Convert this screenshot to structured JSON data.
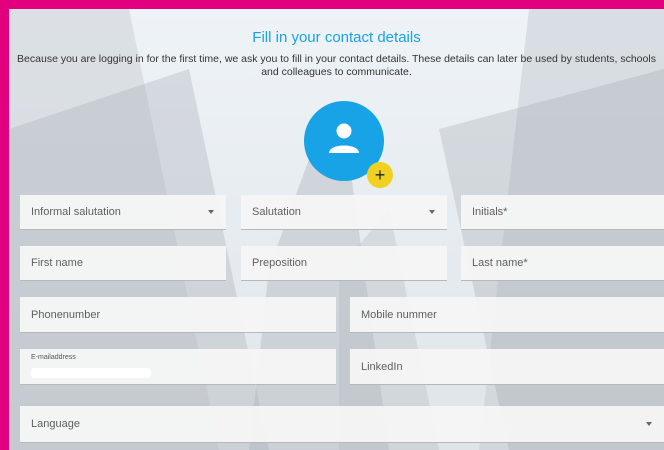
{
  "header": {
    "title": "Fill in your contact details",
    "intro": "Because you are logging in for the first time, we ask you to fill in your contact details. These details can later be used by students, schools and colleagues to communicate."
  },
  "avatar": {
    "icon": "person-icon",
    "add_label": "+"
  },
  "form": {
    "informal_salutation": "Informal salutation",
    "salutation": "Salutation",
    "initials": "Initials*",
    "first_name": "First name",
    "preposition": "Preposition",
    "last_name": "Last name*",
    "phone": "Phonenumber",
    "mobile": "Mobile nummer",
    "email_label": "E-mailaddress",
    "linkedin": "LinkedIn",
    "language": "Language"
  },
  "colors": {
    "border": "#e3007e",
    "title": "#1aa3e0",
    "avatar": "#18a3e6",
    "add_button": "#f0d020"
  }
}
